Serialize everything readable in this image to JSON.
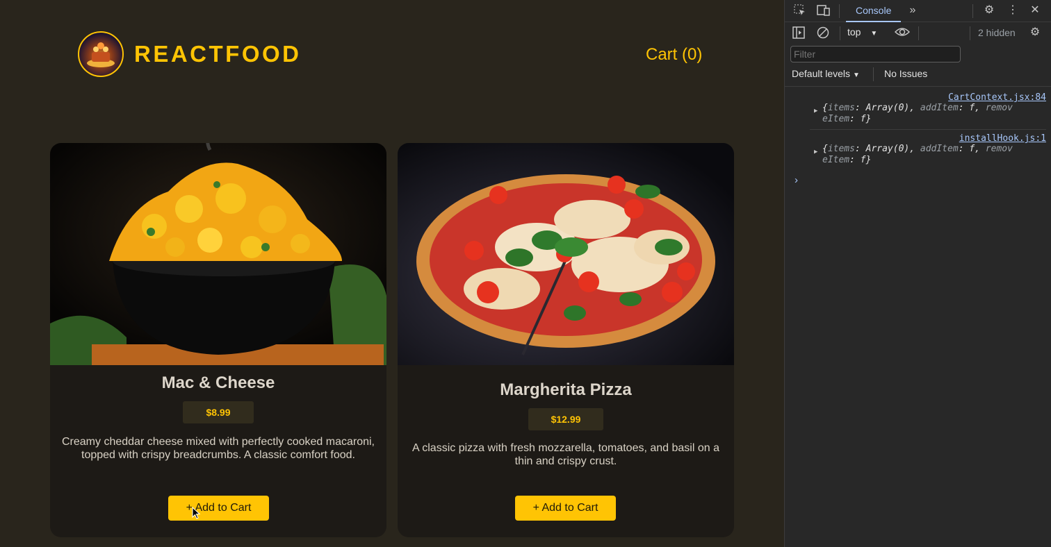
{
  "app": {
    "brand": "REACTFOOD",
    "cart_label": "Cart (0)",
    "meals": [
      {
        "name": "Mac & Cheese",
        "price": "$8.99",
        "description": "Creamy cheddar cheese mixed with perfectly cooked macaroni, topped with crispy breadcrumbs. A classic comfort food.",
        "button": "+ Add to Cart"
      },
      {
        "name": "Margherita Pizza",
        "price": "$12.99",
        "description": "A classic pizza with fresh mozzarella, tomatoes, and basil on a thin and crispy crust.",
        "button": "+ Add to Cart"
      }
    ]
  },
  "devtools": {
    "tab": "Console",
    "context": "top",
    "hidden": "2 hidden",
    "filter_placeholder": "Filter",
    "levels": "Default levels",
    "issues": "No Issues",
    "logs": [
      {
        "source": "CartContext.jsx:84",
        "line1_prefix": "{",
        "line1_k1": "items",
        "line1_v1": ": Array(0), ",
        "line1_k2": "addItem",
        "line1_v2": ": f, ",
        "line1_k3": "remov",
        "line2_k3": "eItem",
        "line2_v3": ": f}"
      },
      {
        "source": "installHook.js:1",
        "line1_prefix": "{",
        "line1_k1": "items",
        "line1_v1": ": Array(0), ",
        "line1_k2": "addItem",
        "line1_v2": ": f, ",
        "line1_k3": "remov",
        "line2_k3": "eItem",
        "line2_v3": ": f}"
      }
    ],
    "prompt": "›"
  },
  "colors": {
    "accent": "#ffc404",
    "page_bg": "#29251c",
    "card_bg": "#1d1a16",
    "devtools_bg": "#282828",
    "link": "#a8c7fa"
  }
}
